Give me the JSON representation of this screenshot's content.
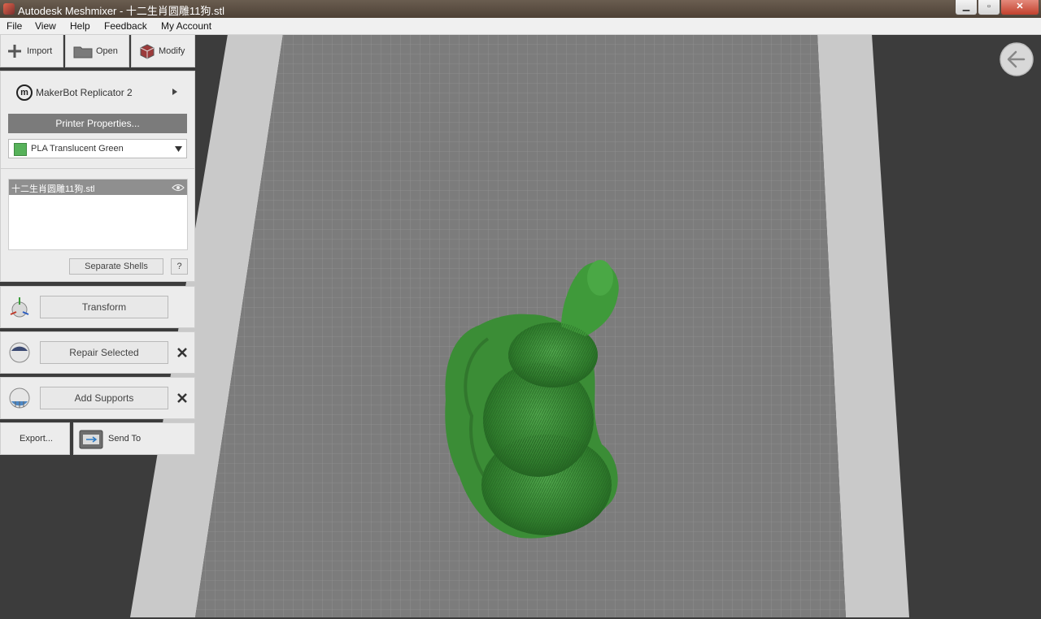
{
  "window": {
    "title": "Autodesk Meshmixer - 十二生肖圆雕11狗.stl",
    "minimize_glyph": "▁",
    "maximize_glyph": "▫",
    "close_glyph": "✕"
  },
  "menu": [
    "File",
    "View",
    "Help",
    "Feedback",
    "My Account"
  ],
  "toolbar": {
    "import": "Import",
    "open": "Open",
    "modify": "Modify"
  },
  "printer": {
    "name": "MakerBot Replicator 2",
    "properties_label": "Printer Properties...",
    "material": "PLA Translucent Green",
    "material_color": "#57b25a"
  },
  "objects": {
    "items": [
      "十二生肖圆雕11狗.stl"
    ],
    "separate_shells": "Separate Shells",
    "help": "?"
  },
  "actions": {
    "transform": "Transform",
    "repair_selected": "Repair Selected",
    "add_supports": "Add Supports",
    "export": "Export...",
    "send_to": "Send To"
  },
  "colors": {
    "model_green": "#3e8f3a",
    "bed_gray": "#7d7d7d",
    "panel": "#ececec"
  }
}
